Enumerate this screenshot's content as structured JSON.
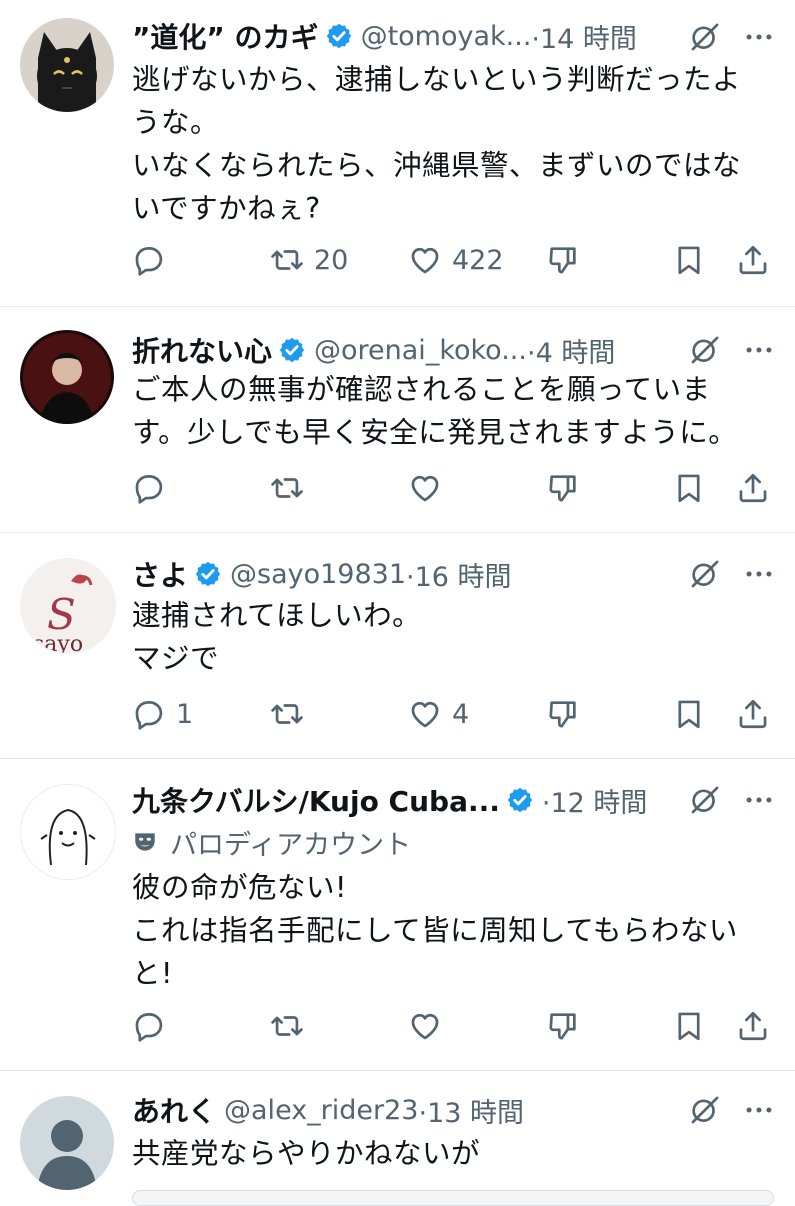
{
  "tweets": [
    {
      "name": "”道化” のカギ",
      "handle": "@tomoyak...",
      "time": "·14 時間",
      "text": "逃げないから、逮捕しないという判断だったよ\nうな。\nいなくなられたら、沖縄県警、まずいのではな\nいですかねぇ?",
      "reply_count": "",
      "retweet_count": "20",
      "like_count": "422",
      "avatar": "black-cat-avatar"
    },
    {
      "name": "折れない心",
      "handle": "@orenai_koko...",
      "time": "·4 時間",
      "text": "ご本人の無事が確認されることを願っていま\nす。少しでも早く安全に発見されますように。",
      "reply_count": "",
      "retweet_count": "",
      "like_count": "",
      "avatar": "dark-figure-avatar"
    },
    {
      "name": "さよ",
      "handle": "@sayo19831",
      "time": "·16 時間",
      "text": "逮捕されてほしいわ。\nマジで",
      "reply_count": "1",
      "retweet_count": "",
      "like_count": "4",
      "avatar": "sayo-logo-avatar"
    },
    {
      "name": "九条クバルシ/Kujo Cuba...",
      "handle": "",
      "time": "·12 時間",
      "parody_label": "パロディアカウント",
      "text": "彼の命が危ない!\nこれは指名手配にして皆に周知してもらわない\nと!",
      "reply_count": "",
      "retweet_count": "",
      "like_count": "",
      "avatar": "doodle-face-avatar"
    },
    {
      "name": "あれく",
      "handle": "@alex_rider23",
      "time": "·13 時間",
      "text": "共産党ならやりかねないが",
      "avatar": "default-avatar"
    }
  ],
  "icons": {
    "reply": "reply-icon",
    "retweet": "retweet-icon",
    "like": "heart-icon",
    "dislike": "dislike-icon",
    "bookmark": "bookmark-icon",
    "share": "share-icon",
    "verified": "verified-badge-icon",
    "grok": "grok-icon",
    "more": "more-icon",
    "parody": "parody-mask-icon"
  },
  "colors": {
    "verified": "#1d9bf0",
    "secondary_text": "#536471",
    "divider": "#e6e9ec"
  }
}
